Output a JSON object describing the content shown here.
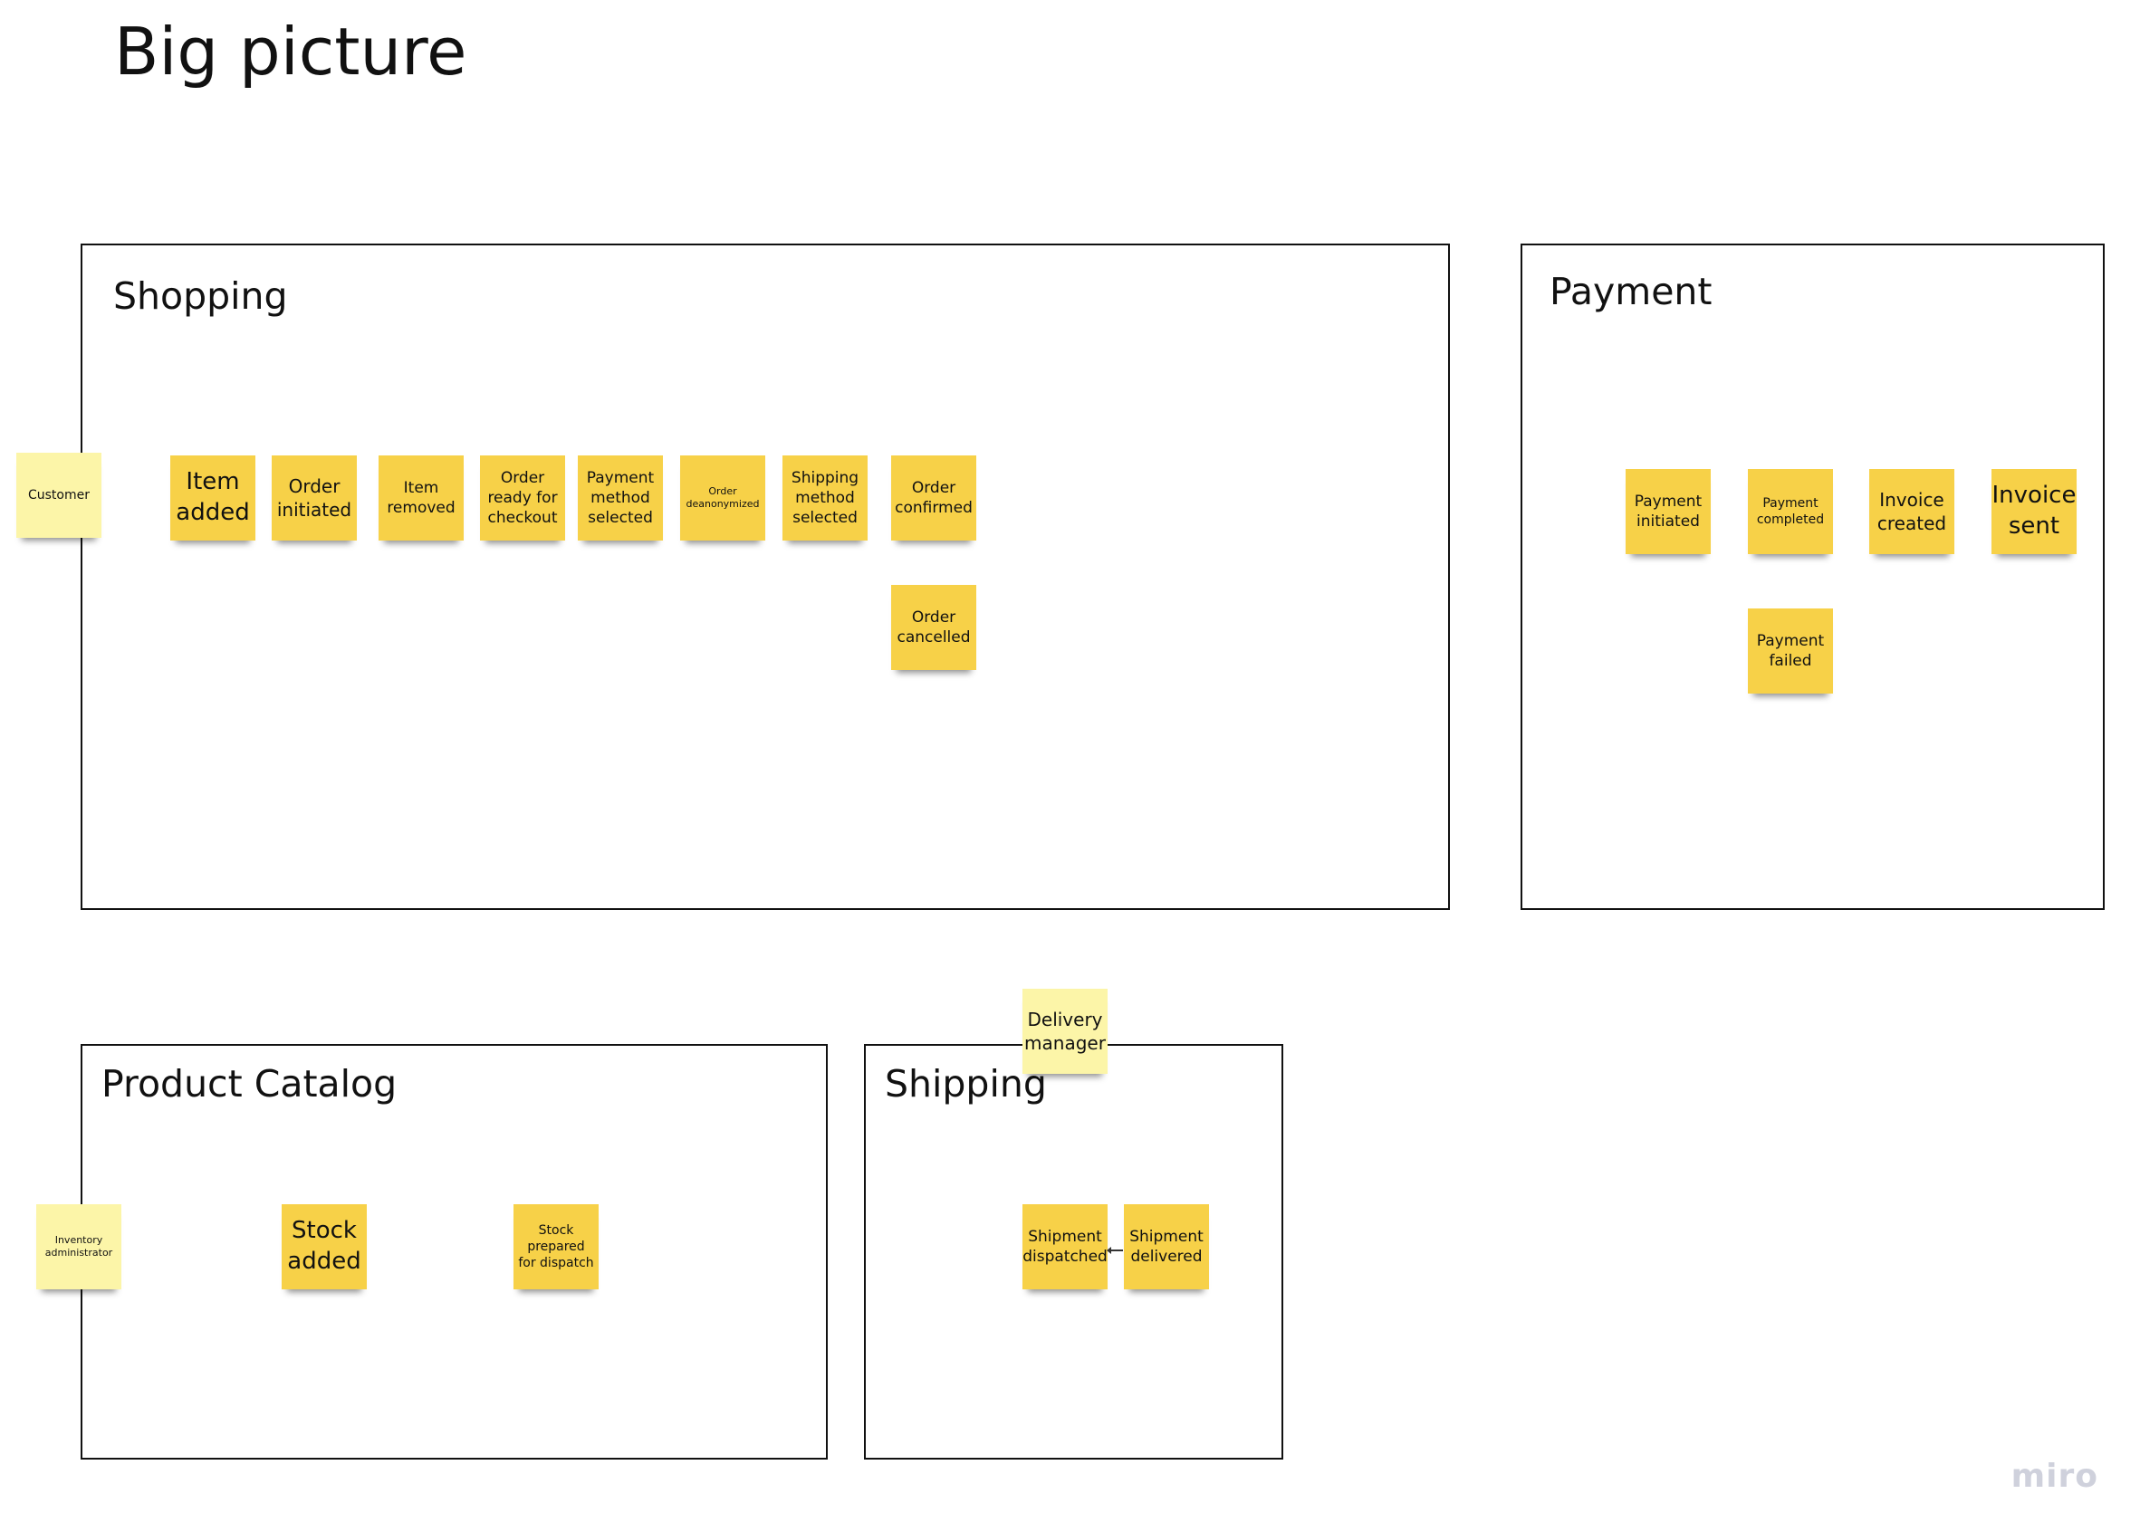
{
  "board": {
    "title": "Big picture"
  },
  "frames": {
    "shopping": "Shopping",
    "payment": "Payment",
    "product_catalog": "Product Catalog",
    "shipping": "Shipping"
  },
  "stickies": {
    "customer": "Customer",
    "item_added": "Item added",
    "order_initiated": "Order initiated",
    "item_removed": "Item removed",
    "order_ready": "Order ready for checkout",
    "payment_method_selected": "Payment method selected",
    "order_deanonymized": "Order deanonymized",
    "shipping_method_selected": "Shipping method selected",
    "order_confirmed": "Order confirmed",
    "order_cancelled": "Order cancelled",
    "payment_initiated": "Payment initiated",
    "payment_completed": "Payment completed",
    "invoice_created": "Invoice created",
    "invoice_sent": "Invoice sent",
    "payment_failed": "Payment failed",
    "delivery_manager": "Delivery manager",
    "inventory_admin": "Inventory administrator",
    "stock_added": "Stock added",
    "stock_prepared": "Stock prepared for dispatch",
    "shipment_dispatched": "Shipment dispatched",
    "shipment_delivered": "Shipment delivered"
  },
  "colors": {
    "event_sticky": "#f7d148",
    "actor_sticky": "#fcf5a8",
    "frame_border": "#111111"
  },
  "brand": {
    "logo_text": "miro"
  }
}
